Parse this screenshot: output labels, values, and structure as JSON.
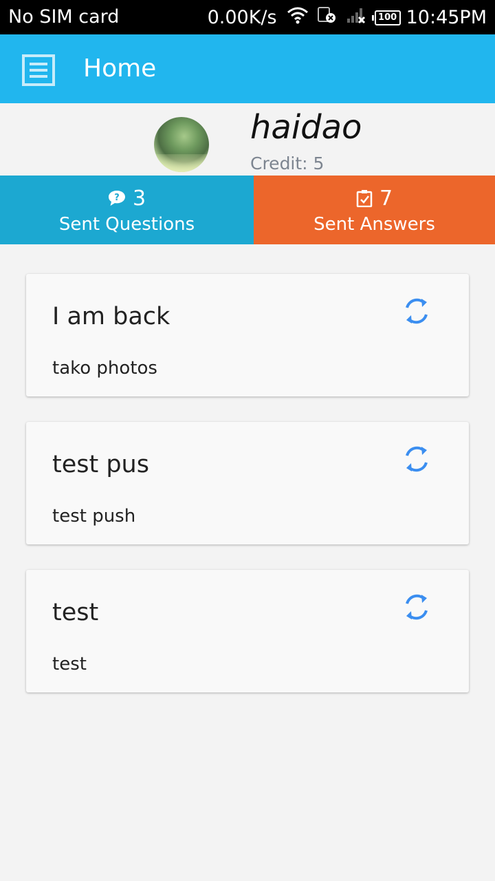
{
  "status_bar": {
    "carrier": "No SIM card",
    "speed": "0.00K/s",
    "battery": "100",
    "time": "10:45PM"
  },
  "app_bar": {
    "title": "Home"
  },
  "profile": {
    "username": "haidao",
    "credit": "Credit: 5"
  },
  "stats": {
    "questions": {
      "count": "3",
      "label": "Sent Questions"
    },
    "answers": {
      "count": "7",
      "label": "Sent Answers"
    }
  },
  "cards": [
    {
      "title": "I am back",
      "body": "tako photos"
    },
    {
      "title": "test pus",
      "body": "test push"
    },
    {
      "title": "test",
      "body": "test"
    }
  ],
  "colors": {
    "status_bar": "#000000",
    "app_bar": "#21b6ee",
    "questions": "#1ca8d1",
    "answers": "#ec662b",
    "refresh_icon": "#3b8ef0"
  },
  "icons": {
    "menu": "menu-icon",
    "questions": "chat-bubble-icon",
    "answers": "clipboard-check-icon",
    "card": "refresh-icon"
  }
}
